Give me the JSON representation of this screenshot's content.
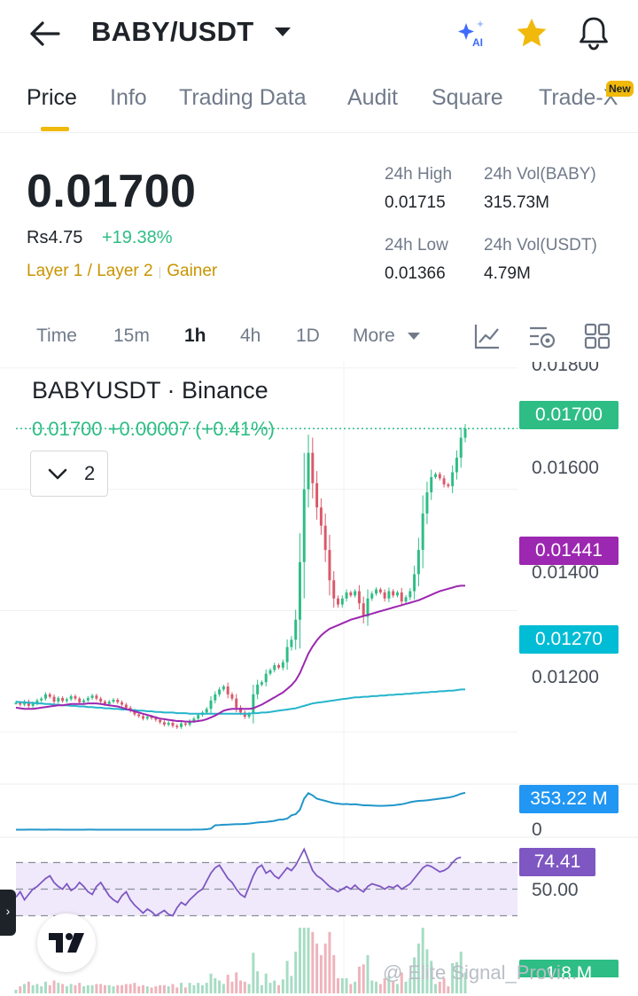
{
  "header": {
    "pair": "BABY/USDT",
    "ai_label": "AI",
    "icons": [
      "back-arrow-icon",
      "caret-down-icon",
      "ai-sparkle-icon",
      "star-icon",
      "bell-icon"
    ]
  },
  "tabs": [
    {
      "label": "Price",
      "active": true
    },
    {
      "label": "Info"
    },
    {
      "label": "Trading Data"
    },
    {
      "label": "Audit"
    },
    {
      "label": "Square"
    },
    {
      "label": "Trade-X"
    }
  ],
  "new_badge": "New",
  "price": {
    "last": "0.01700",
    "fiat": "Rs4.75",
    "change_pct": "+19.38%",
    "tags": [
      "Layer 1 / Layer 2",
      "Gainer"
    ]
  },
  "stats": {
    "high_label": "24h High",
    "high": "0.01715",
    "vol_base_label": "24h Vol(BABY)",
    "vol_base": "315.73M",
    "low_label": "24h Low",
    "low": "0.01366",
    "vol_quote_label": "24h Vol(USDT)",
    "vol_quote": "4.79M"
  },
  "intervals": [
    {
      "label": "Time"
    },
    {
      "label": "15m"
    },
    {
      "label": "1h",
      "active": true
    },
    {
      "label": "4h"
    },
    {
      "label": "1D"
    },
    {
      "label": "More"
    }
  ],
  "chart": {
    "title": "BABYUSDT · Binance",
    "last_line": "0.01700  +0.00007 (+0.41%)",
    "collapse_count": "2",
    "watermark": "@ Elite Signal_Provi...",
    "colors": {
      "up": "#2ebd85",
      "down": "#d9596a",
      "ma_fast": "#9c27b0",
      "ma_slow": "#26b5cc",
      "rsi": "#7e57c2",
      "vol": "#2196c9"
    }
  },
  "chart_data": {
    "type": "candlestick",
    "interval": "1h",
    "ylim": [
      0.0112,
      0.0181
    ],
    "ytick_labels": [
      "0.01800",
      "0.01600",
      "0.01400",
      "0.01200"
    ],
    "yticks": [
      0.018,
      0.016,
      0.014,
      0.012
    ],
    "close": [
      0.01248,
      0.01245,
      0.0125,
      0.01243,
      0.01247,
      0.01252,
      0.01255,
      0.01262,
      0.01258,
      0.0125,
      0.01256,
      0.01251,
      0.01254,
      0.01259,
      0.01255,
      0.01249,
      0.01252,
      0.01256,
      0.0126,
      0.01255,
      0.0125,
      0.01246,
      0.0125,
      0.01253,
      0.01249,
      0.01245,
      0.0124,
      0.01235,
      0.01229,
      0.01226,
      0.01222,
      0.01225,
      0.01223,
      0.0122,
      0.01216,
      0.01212,
      0.01215,
      0.0121,
      0.01208,
      0.01214,
      0.01212,
      0.01218,
      0.01222,
      0.01228,
      0.01232,
      0.01238,
      0.01252,
      0.01262,
      0.0127,
      0.01275,
      0.01262,
      0.01255,
      0.0124,
      0.01232,
      0.01225,
      0.0123,
      0.01262,
      0.01278,
      0.01282,
      0.01296,
      0.01302,
      0.0131,
      0.01306,
      0.01315,
      0.0134,
      0.01352,
      0.01385,
      0.0148,
      0.016,
      0.0166,
      0.0161,
      0.0157,
      0.0154,
      0.015,
      0.0145,
      0.0142,
      0.0141,
      0.0142,
      0.0143,
      0.01425,
      0.01432,
      0.01412,
      0.0139,
      0.0142,
      0.01428,
      0.01435,
      0.0143,
      0.0142,
      0.01432,
      0.01425,
      0.0143,
      0.01415,
      0.01422,
      0.01432,
      0.0146,
      0.015,
      0.0156,
      0.01595,
      0.0162,
      0.01625,
      0.01618,
      0.01608,
      0.01605,
      0.01628,
      0.01652,
      0.01685,
      0.017
    ],
    "series": [
      {
        "name": "",
        "values": [
          0.0124,
          0.01239,
          0.01238,
          0.01238,
          0.01238,
          0.01239,
          0.0124,
          0.01241,
          0.01242,
          0.01243,
          0.01244,
          0.01244,
          0.01245,
          0.01246,
          0.01246,
          0.01246,
          0.01246,
          0.01247,
          0.01247,
          0.01247,
          0.01246,
          0.01245,
          0.01244,
          0.01243,
          0.01242,
          0.0124,
          0.01238,
          0.01236,
          0.01234,
          0.01232,
          0.0123,
          0.01228,
          0.01226,
          0.01224,
          0.01222,
          0.01221,
          0.0122,
          0.01219,
          0.01218,
          0.01218,
          0.01217,
          0.01217,
          0.01217,
          0.01218,
          0.01219,
          0.01221,
          0.01224,
          0.01227,
          0.01231,
          0.01235,
          0.01237,
          0.01238,
          0.01238,
          0.01238,
          0.01238,
          0.01238,
          0.01239,
          0.01242,
          0.01245,
          0.01249,
          0.01253,
          0.01257,
          0.01261,
          0.01265,
          0.01271,
          0.01277,
          0.01285,
          0.01297,
          0.01313,
          0.01329,
          0.01341,
          0.01351,
          0.01359,
          0.01365,
          0.0137,
          0.01373,
          0.01376,
          0.01379,
          0.01382,
          0.01385,
          0.01387,
          0.01389,
          0.01391,
          0.01393,
          0.01395,
          0.01397,
          0.01399,
          0.01401,
          0.01403,
          0.01405,
          0.01407,
          0.01409,
          0.01411,
          0.01413,
          0.01415,
          0.01417,
          0.0142,
          0.01423,
          0.01426,
          0.01429,
          0.01432,
          0.01434,
          0.01436,
          0.01438,
          0.0144,
          0.01441,
          0.01441
        ]
      },
      {
        "name": "",
        "values": [
          0.0125,
          0.01249,
          0.01249,
          0.01248,
          0.01248,
          0.01247,
          0.01247,
          0.01246,
          0.01246,
          0.01245,
          0.01245,
          0.01244,
          0.01244,
          0.01243,
          0.01243,
          0.01242,
          0.01242,
          0.01241,
          0.01241,
          0.0124,
          0.0124,
          0.01239,
          0.01239,
          0.01238,
          0.01238,
          0.01237,
          0.01237,
          0.01236,
          0.01236,
          0.01235,
          0.01235,
          0.01234,
          0.01234,
          0.01233,
          0.01233,
          0.01232,
          0.01232,
          0.01232,
          0.01231,
          0.01231,
          0.01231,
          0.0123,
          0.0123,
          0.0123,
          0.0123,
          0.0123,
          0.0123,
          0.0123,
          0.0123,
          0.0123,
          0.0123,
          0.0123,
          0.0123,
          0.0123,
          0.0123,
          0.0123,
          0.01231,
          0.01231,
          0.01232,
          0.01232,
          0.01233,
          0.01234,
          0.01235,
          0.01236,
          0.01237,
          0.01238,
          0.01239,
          0.01241,
          0.01243,
          0.01245,
          0.01247,
          0.01248,
          0.01249,
          0.0125,
          0.01251,
          0.01252,
          0.01253,
          0.01254,
          0.01255,
          0.01256,
          0.01257,
          0.01257,
          0.01258,
          0.01258,
          0.01259,
          0.01259,
          0.0126,
          0.0126,
          0.01261,
          0.01261,
          0.01262,
          0.01262,
          0.01263,
          0.01263,
          0.01264,
          0.01264,
          0.01265,
          0.01265,
          0.01266,
          0.01266,
          0.01267,
          0.01267,
          0.01268,
          0.01268,
          0.01269,
          0.0127,
          0.0127
        ]
      }
    ],
    "price_tags": [
      {
        "label": "0.01700",
        "value": 0.017,
        "color": "#2ebd85"
      },
      {
        "label": "0.01441",
        "value": 0.01441,
        "color": "#9c27b0"
      },
      {
        "label": "0.01270",
        "value": 0.0127,
        "color": "#00bcd4"
      }
    ],
    "volume_pane": {
      "tag": "353.22 M",
      "zero_label": "0",
      "ylim": [
        0,
        400
      ],
      "values": [
        20,
        20,
        20,
        21,
        21,
        21,
        20,
        20,
        21,
        21,
        21,
        20,
        20,
        20,
        20,
        20,
        20,
        21,
        21,
        20,
        20,
        20,
        20,
        20,
        20,
        20,
        20,
        20,
        20,
        20,
        20,
        20,
        20,
        20,
        20,
        20,
        20,
        20,
        20,
        20,
        20,
        20,
        21,
        21,
        22,
        24,
        30,
        60,
        62,
        65,
        66,
        68,
        70,
        70,
        72,
        75,
        80,
        85,
        88,
        90,
        95,
        100,
        110,
        112,
        120,
        150,
        160,
        200,
        300,
        350,
        330,
        300,
        290,
        280,
        270,
        260,
        255,
        250,
        252,
        248,
        250,
        245,
        240,
        240,
        238,
        236,
        235,
        236,
        238,
        240,
        245,
        250,
        258,
        268,
        275,
        280,
        282,
        285,
        290,
        295,
        300,
        305,
        310,
        318,
        330,
        345,
        353
      ]
    },
    "rsi_pane": {
      "tag": "74.41",
      "mid_label": "50.00",
      "ylim": [
        25,
        85
      ],
      "values": [
        44,
        48,
        42,
        46,
        50,
        52,
        55,
        58,
        60,
        55,
        52,
        50,
        54,
        49,
        51,
        55,
        52,
        48,
        46,
        52,
        55,
        50,
        45,
        42,
        40,
        45,
        48,
        42,
        38,
        35,
        32,
        35,
        33,
        30,
        32,
        34,
        31,
        30,
        36,
        40,
        38,
        42,
        45,
        48,
        50,
        56,
        62,
        66,
        68,
        63,
        58,
        55,
        50,
        46,
        44,
        52,
        60,
        66,
        68,
        62,
        64,
        60,
        58,
        62,
        66,
        64,
        68,
        74,
        80,
        72,
        64,
        60,
        58,
        55,
        52,
        50,
        48,
        50,
        52,
        50,
        53,
        50,
        48,
        52,
        54,
        53,
        52,
        50,
        52,
        51,
        53,
        50,
        52,
        54,
        58,
        62,
        66,
        68,
        67,
        65,
        63,
        64,
        66,
        70,
        73,
        74
      ]
    },
    "bottom_pane": {
      "tag": "1.8 M"
    }
  }
}
